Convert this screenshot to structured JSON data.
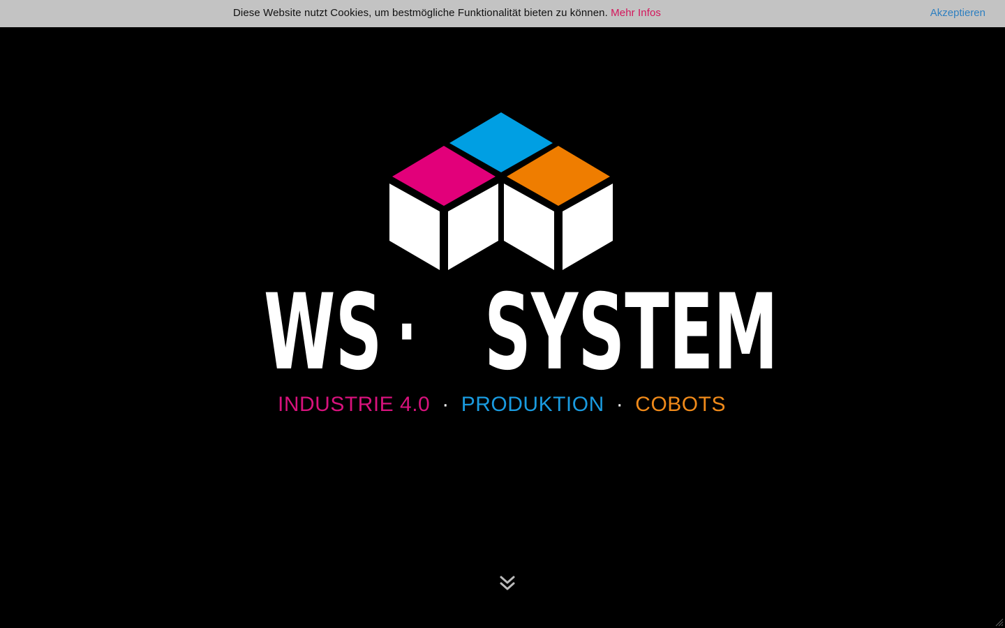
{
  "cookie_bar": {
    "message": "Diese Website nutzt Cookies, um bestmögliche Funktionalität bieten zu können.",
    "more_info_label": "Mehr Infos",
    "accept_label": "Akzeptieren"
  },
  "hero": {
    "logo_word_left": "WS",
    "logo_separator": "·",
    "logo_word_right": "SYSTEM",
    "tagline": {
      "item1": "INDUSTRIE 4.0",
      "item2": "PRODUKTION",
      "item3": "COBOTS",
      "separator": "·"
    }
  },
  "icons": {
    "logo": "stacked-cubes-logo-icon",
    "scroll": "double-chevron-down-icon",
    "resize": "resize-grip-icon"
  },
  "colors": {
    "magenta": "#e2007a",
    "blue": "#009fe3",
    "orange": "#ef7d00",
    "background": "#000000",
    "cookie_bar_bg": "#c3c3c3",
    "accept_link": "#2d7fc0",
    "more_info_link": "#d4145a"
  }
}
